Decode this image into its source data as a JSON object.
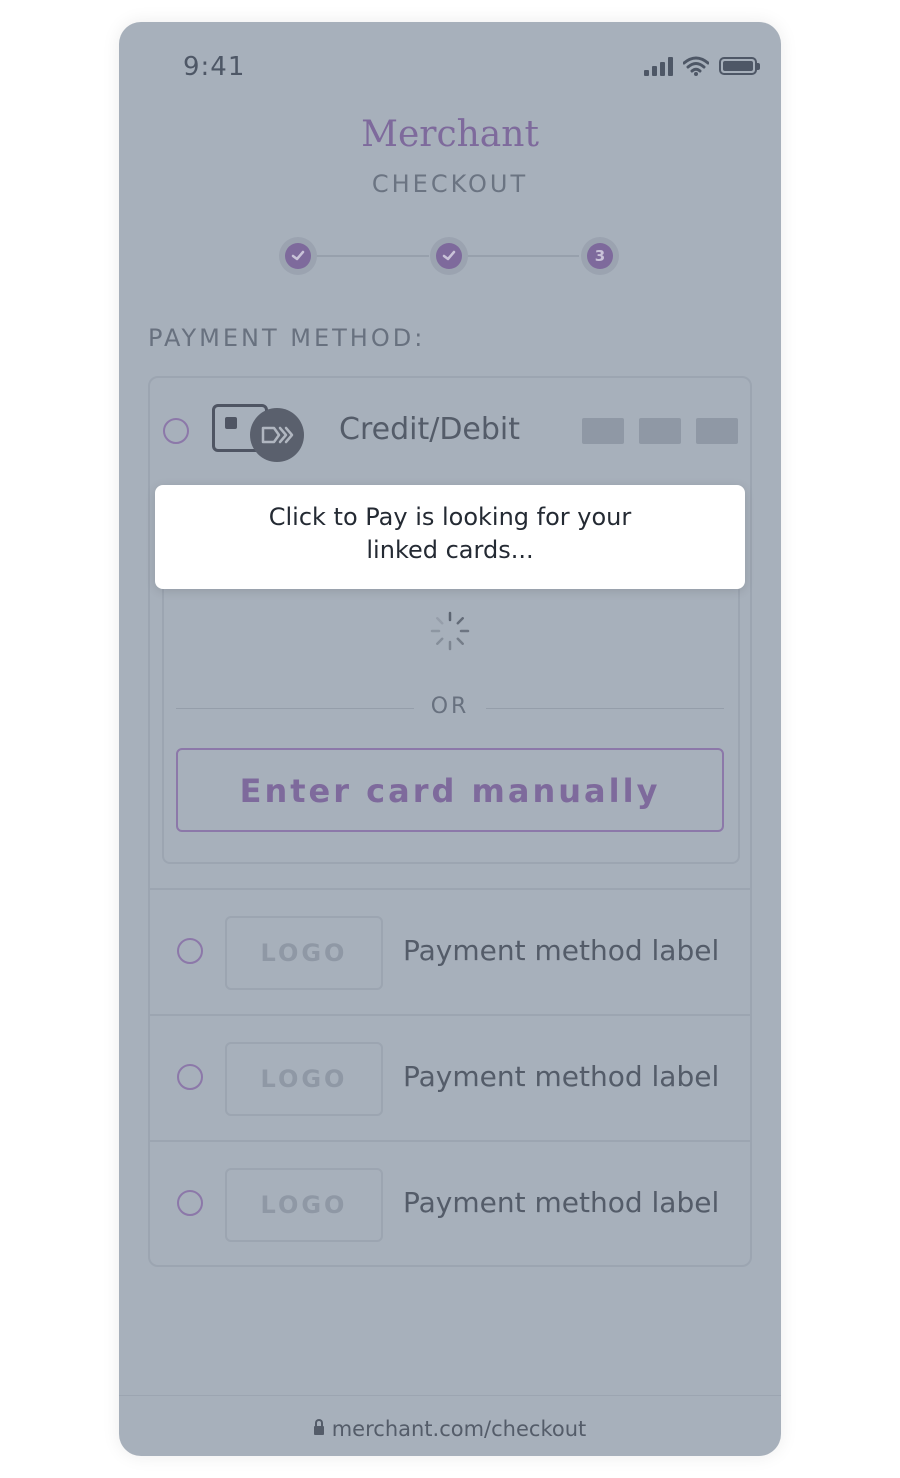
{
  "status_bar": {
    "time": "9:41"
  },
  "header": {
    "brand": "Merchant",
    "subtitle": "CHECKOUT"
  },
  "stepper": {
    "steps": [
      {
        "state": "complete",
        "icon": "check-icon"
      },
      {
        "state": "complete",
        "icon": "check-icon"
      },
      {
        "state": "current",
        "label": "3"
      }
    ]
  },
  "payment": {
    "section_label": "PAYMENT METHOD:",
    "credit_debit": {
      "label": "Credit/Debit",
      "icon": "click-to-pay-card-icon",
      "toast": "Click to Pay is looking for your linked cards...",
      "or_label": "OR",
      "manual_button": "Enter card manually"
    },
    "methods": [
      {
        "logo": "LOGO",
        "label": "Payment method label"
      },
      {
        "logo": "LOGO",
        "label": "Payment method label"
      },
      {
        "logo": "LOGO",
        "label": "Payment method label"
      }
    ]
  },
  "url_bar": {
    "url": "merchant.com/checkout",
    "icon": "lock-icon"
  },
  "colors": {
    "accent": "#7e6a9c",
    "overlay": "#a7b0bb",
    "toast_bg": "#ffffff"
  }
}
